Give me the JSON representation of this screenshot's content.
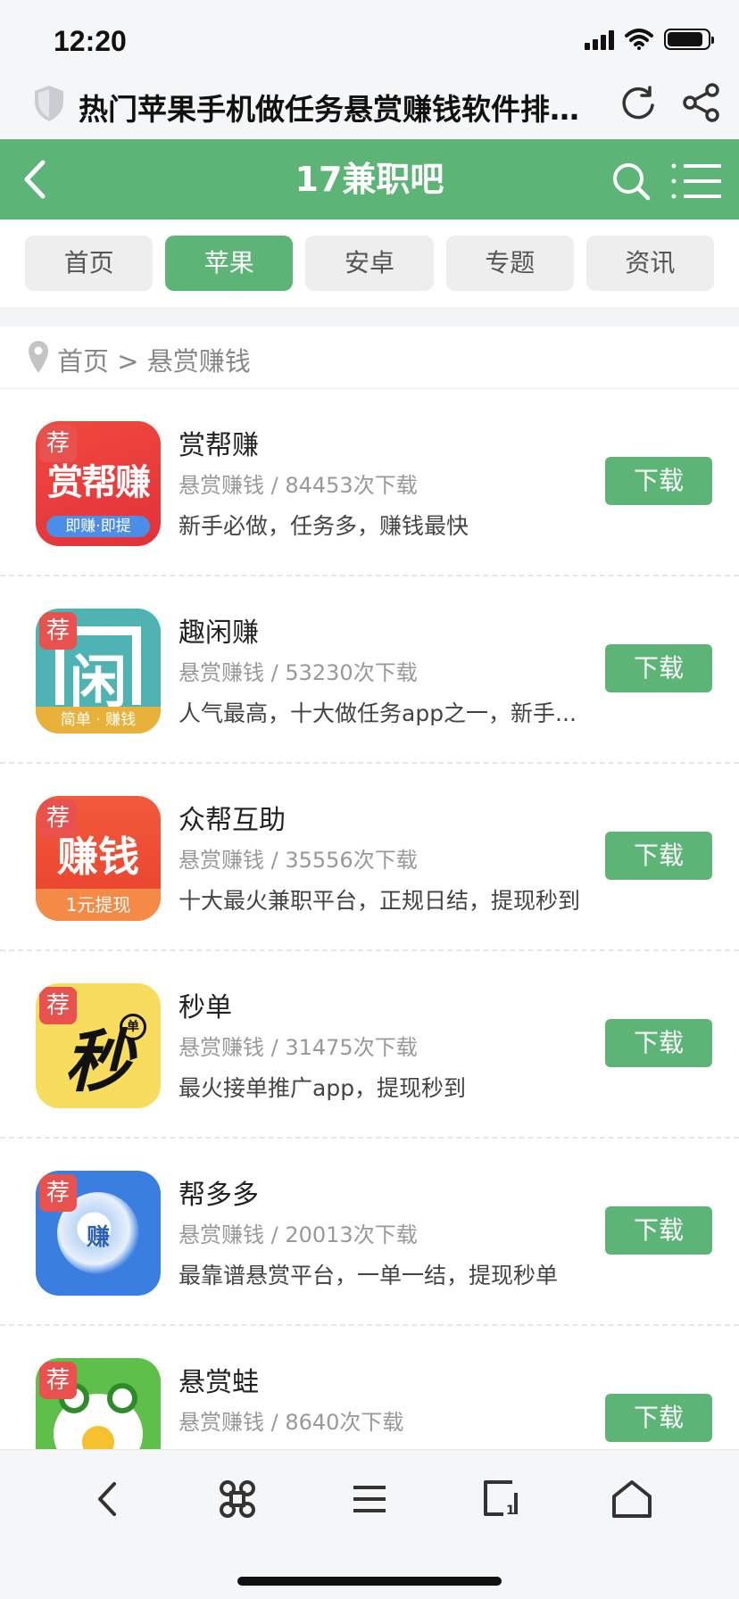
{
  "status_bar": {
    "time": "12:20"
  },
  "browser": {
    "page_title": "热门苹果手机做任务悬赏赚钱软件排行..."
  },
  "site": {
    "title": "17兼职吧"
  },
  "tabs": [
    {
      "label": "首页",
      "active": false
    },
    {
      "label": "苹果",
      "active": true
    },
    {
      "label": "安卓",
      "active": false
    },
    {
      "label": "专题",
      "active": false
    },
    {
      "label": "资讯",
      "active": false
    }
  ],
  "breadcrumb": {
    "text": "首页 > 悬赏赚钱"
  },
  "apps": [
    {
      "name": "赏帮赚",
      "meta": "悬赏赚钱 / 84453次下载",
      "desc": "新手必做，任务多，赚钱最快",
      "button": "下载",
      "badge": "荐",
      "icon_text": "赏帮赚",
      "icon_sub": "即赚·即提"
    },
    {
      "name": "趣闲赚",
      "meta": "悬赏赚钱 / 53230次下载",
      "desc": "人气最高，十大做任务app之一，新手...",
      "button": "下载",
      "badge": "荐",
      "icon_text": "闲",
      "icon_sub": "简单 · 赚钱"
    },
    {
      "name": "众帮互助",
      "meta": "悬赏赚钱 / 35556次下载",
      "desc": "十大最火兼职平台，正规日结，提现秒到",
      "button": "下载",
      "badge": "荐",
      "icon_text": "赚钱",
      "icon_sub": "1元提现"
    },
    {
      "name": "秒单",
      "meta": "悬赏赚钱 / 31475次下载",
      "desc": "最火接单推广app，提现秒到",
      "button": "下载",
      "badge": "荐",
      "icon_text": "秒",
      "icon_sub": "单"
    },
    {
      "name": "帮多多",
      "meta": "悬赏赚钱 / 20013次下载",
      "desc": "最靠谱悬赏平台，一单一结，提现秒单",
      "button": "下载",
      "badge": "荐",
      "icon_text": "赚",
      "icon_sub": ""
    },
    {
      "name": "悬赏蛙",
      "meta": "悬赏赚钱 / 8640次下载",
      "desc": "",
      "button": "下载",
      "badge": "荐",
      "icon_text": "",
      "icon_sub": ""
    }
  ],
  "colors": {
    "brand_green": "#5db477",
    "badge_red": "#e8514d"
  },
  "icons": {
    "toolbar": [
      "back-icon",
      "apps-icon",
      "menu-icon",
      "tabs-icon",
      "home-icon"
    ]
  }
}
